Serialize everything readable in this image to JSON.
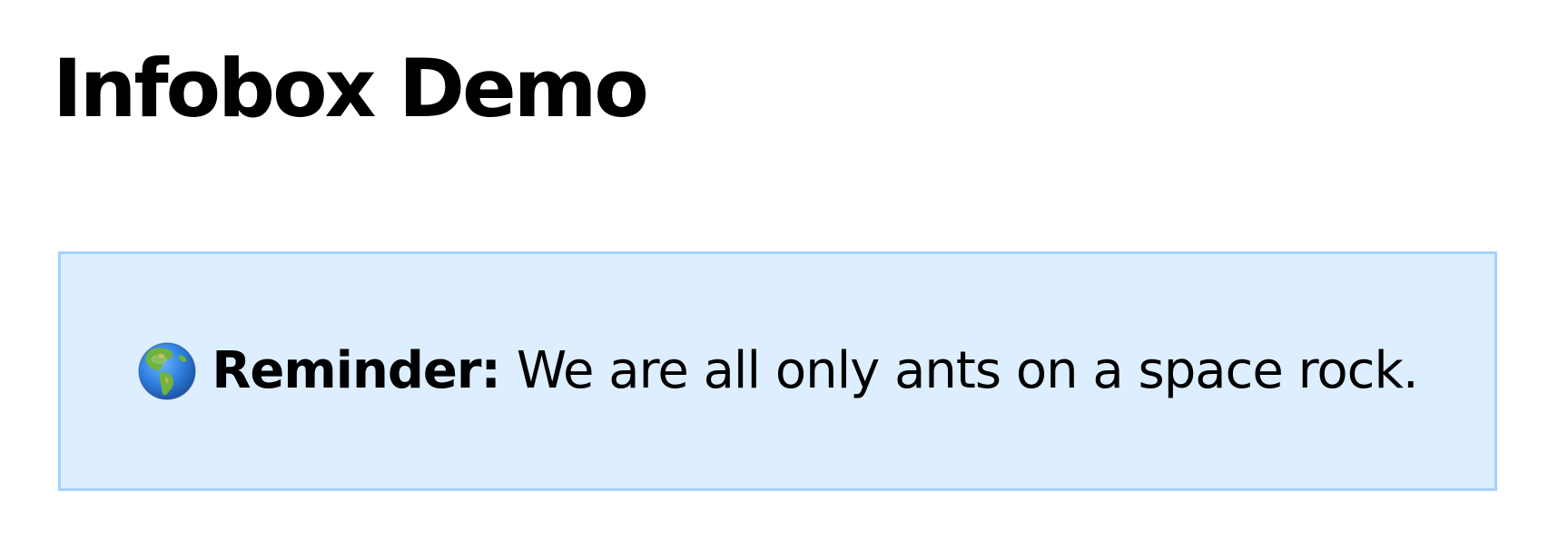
{
  "page": {
    "title": "Infobox Demo"
  },
  "infobox": {
    "icon": "globe-americas-icon",
    "label": "Reminder:",
    "message": "We are all only ants on a space rock.",
    "background_color": "#ddeeff",
    "border_color": "#a6d1ff"
  }
}
